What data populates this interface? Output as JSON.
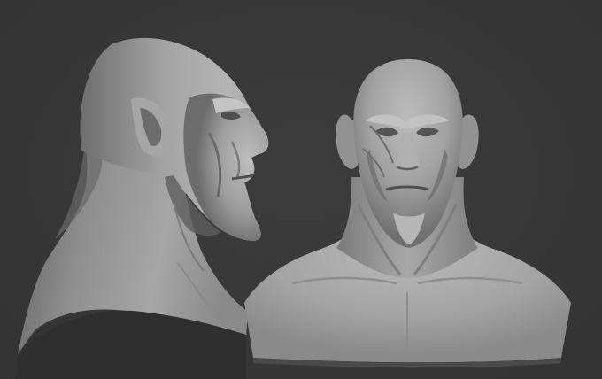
{
  "scene": {
    "background_color": "#383838",
    "clay_color": "#9a9a9a",
    "subjects": [
      "sculpt-side-view",
      "sculpt-front-view"
    ]
  }
}
